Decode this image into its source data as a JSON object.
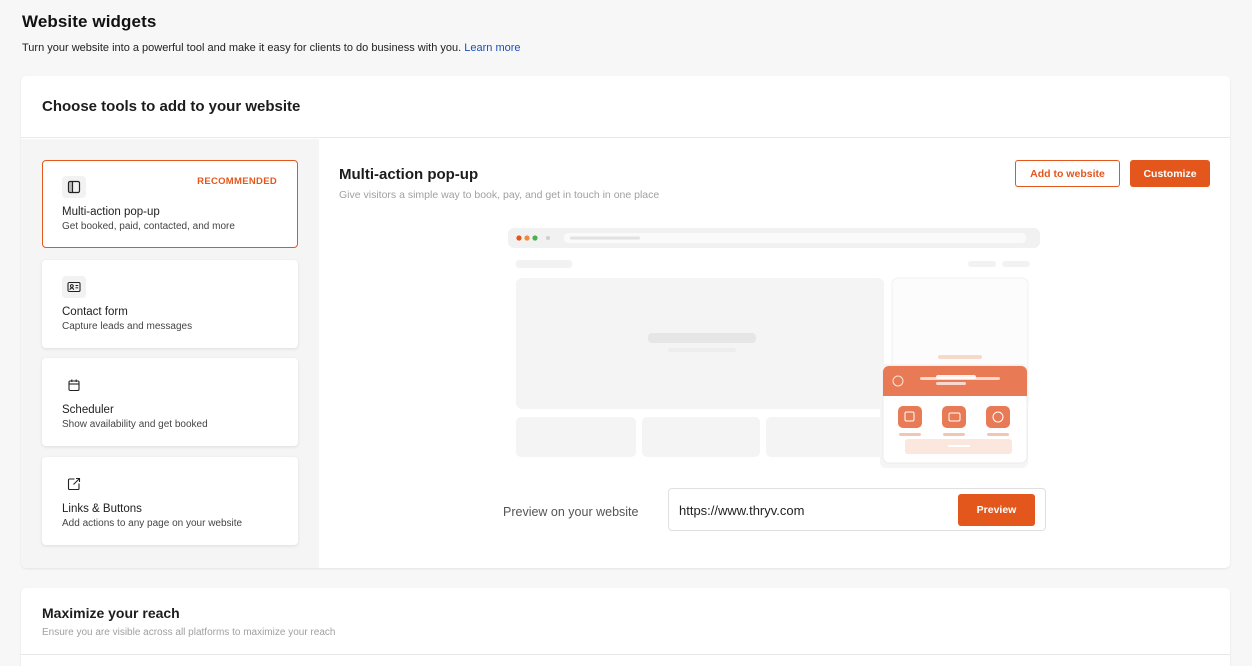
{
  "header": {
    "title": "Website widgets",
    "subtitle": "Turn your website into a powerful tool and make it easy for clients to do business with you.",
    "learn_more": "Learn more"
  },
  "tools_section": {
    "title": "Choose tools to add to your website",
    "tools": [
      {
        "name": "Multi-action pop-up",
        "desc": "Get booked, paid, contacted, and more",
        "badge": "RECOMMENDED",
        "icon": "layout-panel-icon",
        "selected": true
      },
      {
        "name": "Contact form",
        "desc": "Capture leads and messages",
        "icon": "contact-card-icon"
      },
      {
        "name": "Scheduler",
        "desc": "Show availability and get booked",
        "icon": "calendar-icon"
      },
      {
        "name": "Links & Buttons",
        "desc": "Add actions to any page on your website",
        "icon": "external-link-icon"
      }
    ]
  },
  "detail": {
    "title": "Multi-action pop-up",
    "desc": "Give visitors a simple way to book, pay, and get in touch in one place",
    "add_button": "Add to website",
    "customize_button": "Customize",
    "preview_label": "Preview on your website",
    "url_value": "https://www.thryv.com",
    "preview_button": "Preview"
  },
  "reach_section": {
    "title": "Maximize your reach",
    "desc": "Ensure you are visible across all platforms to maximize your reach"
  },
  "colors": {
    "accent": "#e3561c",
    "link": "#1b4fb8"
  }
}
